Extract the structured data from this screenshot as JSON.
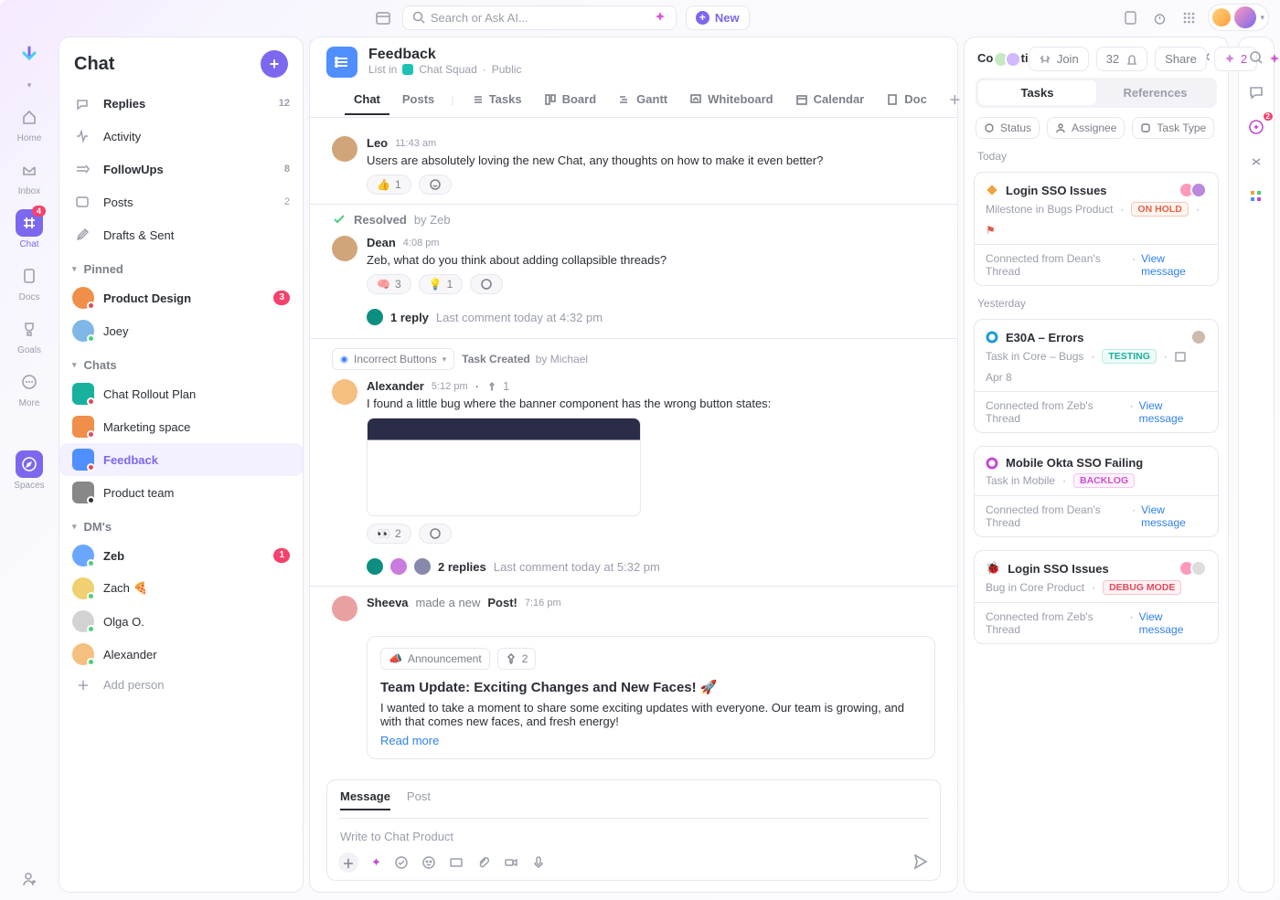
{
  "topbar": {
    "search_placeholder": "Search or Ask AI...",
    "new_label": "New"
  },
  "rail": {
    "items": [
      {
        "label": "Home",
        "icon": "home-icon"
      },
      {
        "label": "Inbox",
        "icon": "inbox-icon"
      },
      {
        "label": "Chat",
        "icon": "hash-icon",
        "badge": "4",
        "active": true
      },
      {
        "label": "Docs",
        "icon": "doc-icon"
      },
      {
        "label": "Goals",
        "icon": "trophy-icon"
      },
      {
        "label": "More",
        "icon": "more-icon"
      },
      {
        "label": "Spaces",
        "icon": "compass-icon"
      }
    ]
  },
  "left": {
    "title": "Chat",
    "rows": [
      {
        "label": "Replies",
        "count": "12",
        "bold": true,
        "icon": "reply-icon"
      },
      {
        "label": "Activity",
        "icon": "activity-icon"
      },
      {
        "label": "FollowUps",
        "count": "8",
        "bold": true,
        "icon": "follow-icon"
      },
      {
        "label": "Posts",
        "count": "2",
        "icon": "posts-icon"
      },
      {
        "label": "Drafts & Sent",
        "icon": "draft-icon"
      }
    ],
    "sections": {
      "pinned": "Pinned",
      "chats": "Chats",
      "dms": "DM's"
    },
    "pinned": [
      {
        "label": "Product Design",
        "badge": "3",
        "bold": true,
        "color": "#f08f4a"
      },
      {
        "label": "Joey",
        "color": "#7fb7e6"
      }
    ],
    "chats": [
      {
        "label": "Chat Rollout Plan",
        "color": "#18b19e"
      },
      {
        "label": "Marketing space",
        "color": "#f08f4a"
      },
      {
        "label": "Feedback",
        "active": true,
        "color": "#4f8fff"
      },
      {
        "label": "Product team",
        "color": "#888"
      }
    ],
    "dms": [
      {
        "label": "Zeb",
        "badge": "1",
        "bold": true,
        "color": "#6aa6ff"
      },
      {
        "label": "Zach",
        "emoji": "🍕",
        "color": "#f0d070"
      },
      {
        "label": "Olga O.",
        "color": "#d3d3d3"
      },
      {
        "label": "Alexander",
        "color": "#f5bf7f"
      }
    ],
    "add_label": "Add person"
  },
  "header": {
    "title": "Feedback",
    "list_prefix": "List in",
    "space": "Chat Squad",
    "visibility": "Public",
    "join": "Join",
    "count": "32",
    "share": "Share",
    "ai": "2"
  },
  "views": [
    {
      "label": "Chat",
      "active": true
    },
    {
      "label": "Posts"
    },
    {
      "icon": "list-icon",
      "label": "Tasks"
    },
    {
      "icon": "board-icon",
      "label": "Board"
    },
    {
      "icon": "gantt-icon",
      "label": "Gantt"
    },
    {
      "icon": "whiteboard-icon",
      "label": "Whiteboard"
    },
    {
      "icon": "calendar-icon",
      "label": "Calendar"
    },
    {
      "icon": "docview-icon",
      "label": "Doc"
    }
  ],
  "feed": {
    "msg1": {
      "name": "Leo",
      "time": "11:43 am",
      "body": "Users are absolutely loving the new Chat, any thoughts on how to make it even better?",
      "react": [
        {
          "e": "👍",
          "n": "1"
        }
      ]
    },
    "resolved": {
      "label": "Resolved",
      "by": "by Zeb"
    },
    "msg2": {
      "name": "Dean",
      "time": "4:08 pm",
      "body": "Zeb, what do you think about adding collapsible threads?",
      "react": [
        {
          "e": "🧠",
          "n": "3"
        },
        {
          "e": "💡",
          "n": "1"
        }
      ],
      "reply_count": "1 reply",
      "reply_meta": "Last comment today at 4:32 pm"
    },
    "task_chip": {
      "tag": "Incorrect Buttons",
      "created": "Task Created",
      "by": "by Michael"
    },
    "msg3": {
      "name": "Alexander",
      "time": "5:12 pm",
      "pin": "1",
      "body": "I found a little bug where the banner component has the wrong button states:",
      "react": [
        {
          "e": "👀",
          "n": "2"
        }
      ],
      "reply_count": "2 replies",
      "reply_meta": "Last comment today at 5:32 pm"
    },
    "msg4": {
      "name": "Sheeva",
      "verb": " made a new ",
      "post_word": "Post!",
      "time": "7:16 pm"
    },
    "post": {
      "tag": "Announcement",
      "pin": "2",
      "title": "Team Update: Exciting Changes and New Faces! 🚀",
      "body": "I wanted to take a moment to share some exciting updates with everyone. Our team is growing, and with that comes new faces, and fresh energy!",
      "more": "Read more"
    }
  },
  "composer": {
    "tab_message": "Message",
    "tab_post": "Post",
    "placeholder": "Write to Chat Product"
  },
  "connections": {
    "title": "Connections",
    "tabs": {
      "tasks": "Tasks",
      "refs": "References"
    },
    "filters": [
      "Status",
      "Assignee",
      "Task Type"
    ],
    "today": "Today",
    "yesterday": "Yesterday",
    "items": [
      {
        "icon": "diamond",
        "color": "#f0a23c",
        "title": "Login SSO Issues",
        "sub": "Milestone in Bugs Product",
        "status": "ON HOLD",
        "status_class": "s-hold",
        "flag": true,
        "from": "Connected from Dean's Thread",
        "link": "View message",
        "avatars": 2
      },
      {
        "icon": "circle",
        "color": "#1d9cd6",
        "title": "E30A – Errors",
        "sub": "Task in Core – Bugs",
        "status": "TESTING",
        "status_class": "s-test",
        "date": "Apr 8",
        "from": "Connected from Zeb's Thread",
        "link": "View message",
        "avatars": 1
      },
      {
        "icon": "circle",
        "color": "#c04ccf",
        "title": "Mobile Okta SSO Failing",
        "sub": "Task in Mobile",
        "status": "BACKLOG",
        "status_class": "s-back",
        "from": "Connected from Dean's Thread",
        "link": "View message"
      },
      {
        "icon": "bug",
        "color": "#e24a5e",
        "title": "Login SSO Issues",
        "sub": "Bug in Core Product",
        "status": "DEBUG MODE",
        "status_class": "s-debug",
        "from": "Connected from Zeb's Thread",
        "link": "View message",
        "avatars": 2
      }
    ]
  }
}
